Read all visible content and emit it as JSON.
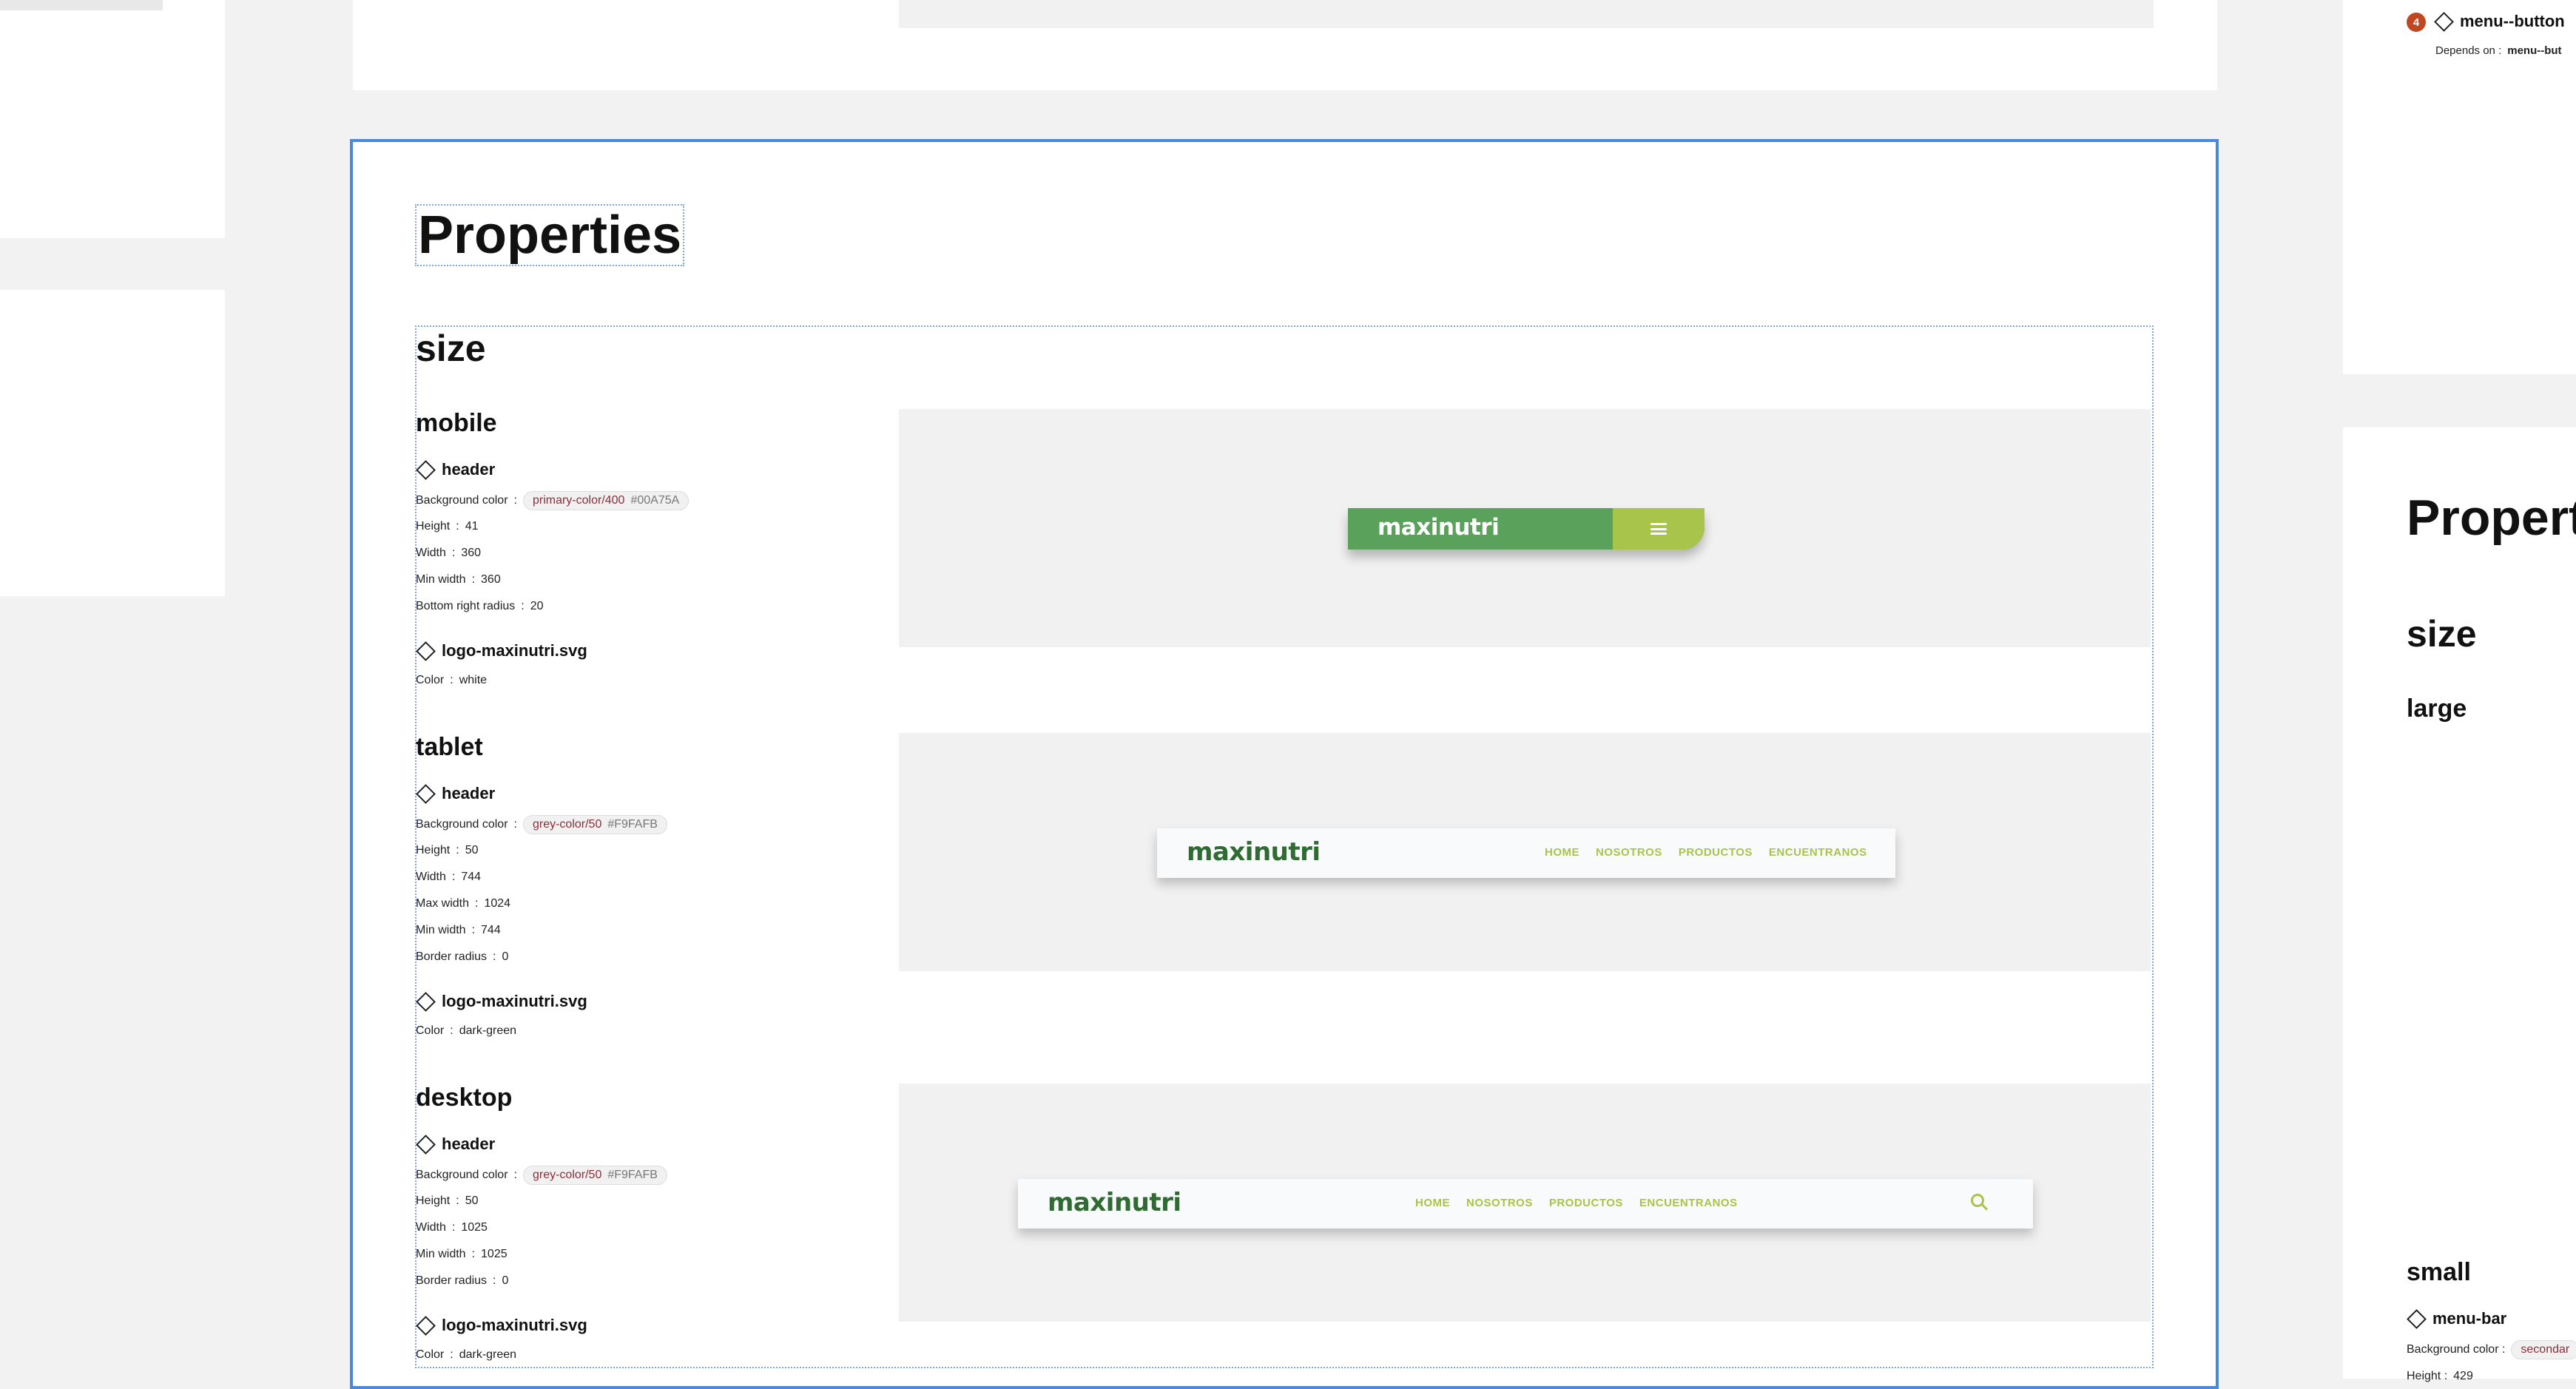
{
  "main": {
    "title": "Properties",
    "size_heading": "size",
    "prop_sep": ":",
    "breakpoints": {
      "mobile": {
        "title": "mobile",
        "header": {
          "name": "header",
          "bg_label": "Background color",
          "bg_token": "primary-color/400",
          "bg_hex": "#00A75A",
          "props": [
            {
              "label": "Height",
              "value": "41"
            },
            {
              "label": "Width",
              "value": "360"
            },
            {
              "label": "Min width",
              "value": "360"
            },
            {
              "label": "Bottom right radius",
              "value": "20"
            }
          ]
        },
        "logo": {
          "name": "logo-maxinutri.svg",
          "color_label": "Color",
          "color_value": "white"
        }
      },
      "tablet": {
        "title": "tablet",
        "header": {
          "name": "header",
          "bg_label": "Background color",
          "bg_token": "grey-color/50",
          "bg_hex": "#F9FAFB",
          "props": [
            {
              "label": "Height",
              "value": "50"
            },
            {
              "label": "Width",
              "value": "744"
            },
            {
              "label": "Max width",
              "value": "1024"
            },
            {
              "label": "Min width",
              "value": "744"
            },
            {
              "label": "Border radius",
              "value": "0"
            }
          ]
        },
        "logo": {
          "name": "logo-maxinutri.svg",
          "color_label": "Color",
          "color_value": "dark-green"
        }
      },
      "desktop": {
        "title": "desktop",
        "header": {
          "name": "header",
          "bg_label": "Background color",
          "bg_token": "grey-color/50",
          "bg_hex": "#F9FAFB",
          "props": [
            {
              "label": "Height",
              "value": "50"
            },
            {
              "label": "Width",
              "value": "1025"
            },
            {
              "label": "Min width",
              "value": "1025"
            },
            {
              "label": "Border radius",
              "value": "0"
            }
          ]
        },
        "logo": {
          "name": "logo-maxinutri.svg",
          "color_label": "Color",
          "color_value": "dark-green"
        }
      }
    }
  },
  "preview": {
    "logo_text": "maxinutri",
    "nav": [
      "HOME",
      "NOSOTROS",
      "PRODUCTOS",
      "ENCUENTRANOS"
    ],
    "colors": {
      "primary": "#5aa25b",
      "accent": "#a9c44b",
      "dark_green": "#2f6b32",
      "header_bg": "#f9fafb"
    }
  },
  "right_panel": {
    "badge": "4",
    "component": "menu--button",
    "depends_label": "Depends on :",
    "depends_value": "menu--but",
    "title": "Propert",
    "size_heading": "size",
    "large": "large",
    "small": "small",
    "menu_bar": "menu-bar",
    "bg_label": "Background color :",
    "bg_token": "secondar",
    "height_label": "Height :",
    "height_value": "429"
  },
  "colors": {
    "selection": "#4a88dc",
    "canvas": "#f2f2f2"
  }
}
